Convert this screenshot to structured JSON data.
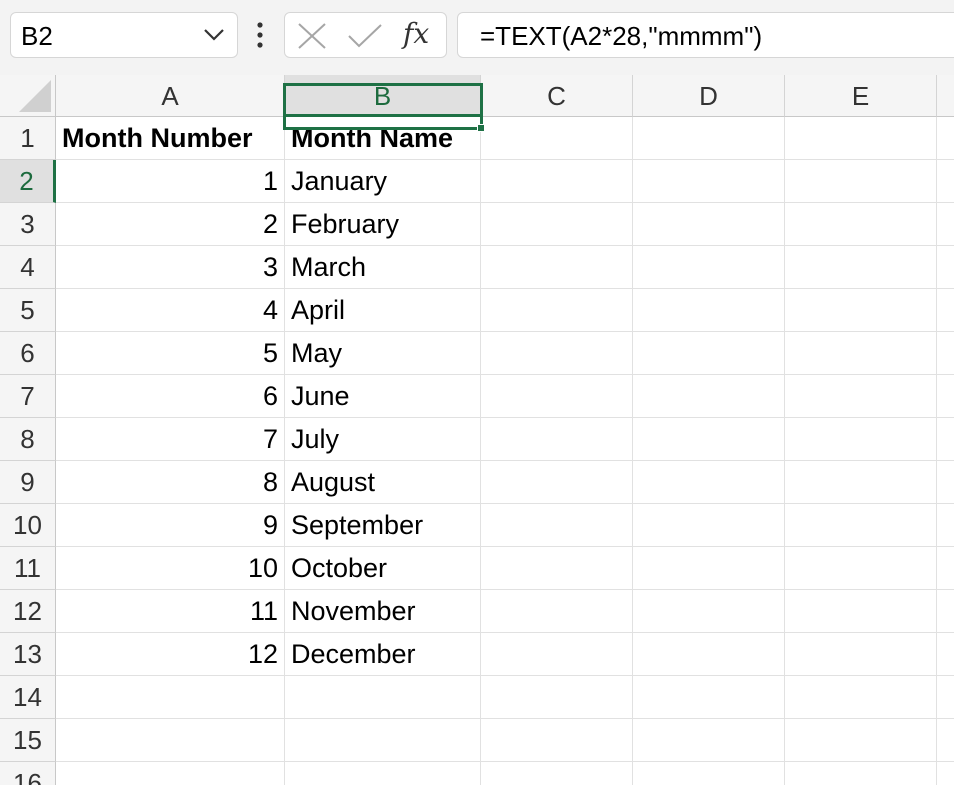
{
  "formula_bar": {
    "name_box": "B2",
    "fx_label": "fx",
    "formula": "=TEXT(A2*28,\"mmmm\")"
  },
  "sheet": {
    "columns": [
      "A",
      "B",
      "C",
      "D",
      "E"
    ],
    "rows": [
      "1",
      "2",
      "3",
      "4",
      "5",
      "6",
      "7",
      "8",
      "9",
      "10",
      "11",
      "12",
      "13",
      "14",
      "15",
      "16"
    ],
    "selected_cell": "B2",
    "cells": {
      "A1": "Month Number",
      "B1": "Month Name",
      "A2": "1",
      "B2": "January",
      "A3": "2",
      "B3": "February",
      "A4": "3",
      "B4": "March",
      "A5": "4",
      "B5": "April",
      "A6": "5",
      "B6": "May",
      "A7": "6",
      "B7": "June",
      "A8": "7",
      "B8": "July",
      "A9": "8",
      "B9": "August",
      "A10": "9",
      "B10": "September",
      "A11": "10",
      "B11": "October",
      "A12": "11",
      "B12": "November",
      "A13": "12",
      "B13": "December"
    }
  },
  "colors": {
    "accent": "#1e7145"
  }
}
